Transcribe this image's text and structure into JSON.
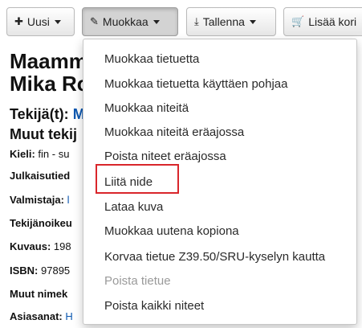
{
  "toolbar": {
    "new_label": "Uusi",
    "edit_label": "Muokkaa",
    "save_label": "Tallenna",
    "add_to_cart_label": "Lisää kori",
    "icons": {
      "new": "plus-icon",
      "edit": "pencil-icon",
      "save": "download-icon",
      "cart": "cart-icon"
    }
  },
  "record": {
    "title_line1": "Maamm",
    "title_line2": "Mika Ro",
    "author_label": "Tekijä(t):",
    "author_value": "M",
    "other_authors_label": "Muut tekij",
    "language_label": "Kieli:",
    "language_value": "fin - su",
    "publication_label": "Julkaisutied",
    "producer_label": "Valmistaja:",
    "producer_value": "l",
    "copyright_label": "Tekijänoikeu",
    "description_label": "Kuvaus:",
    "description_value": "198",
    "isbn_label": "ISBN:",
    "isbn_value": "97895",
    "other_titles_label": "Muut nimek",
    "subjects_label": "Asiasanat:",
    "subjects_value": "H"
  },
  "menu": {
    "items": [
      {
        "label": "Muokkaa tietuetta",
        "disabled": false
      },
      {
        "label": "Muokkaa tietuetta käyttäen pohjaa",
        "disabled": false
      },
      {
        "label": "Muokkaa niteitä",
        "disabled": false
      },
      {
        "label": "Muokkaa niteitä eräajossa",
        "disabled": false
      },
      {
        "label": "Poista niteet eräajossa",
        "disabled": false
      },
      {
        "label": "Liitä nide",
        "disabled": false,
        "highlighted": true
      },
      {
        "label": "Lataa kuva",
        "disabled": false
      },
      {
        "label": "Muokkaa uutena kopiona",
        "disabled": false
      },
      {
        "label": "Korvaa tietue Z39.50/SRU-kyselyn kautta",
        "disabled": false
      },
      {
        "label": "Poista tietue",
        "disabled": true
      },
      {
        "label": "Poista kaikki niteet",
        "disabled": false
      }
    ]
  },
  "colors": {
    "highlight_border": "#d9262b",
    "link": "#0b57b0",
    "disabled_text": "#9a9a9a"
  }
}
